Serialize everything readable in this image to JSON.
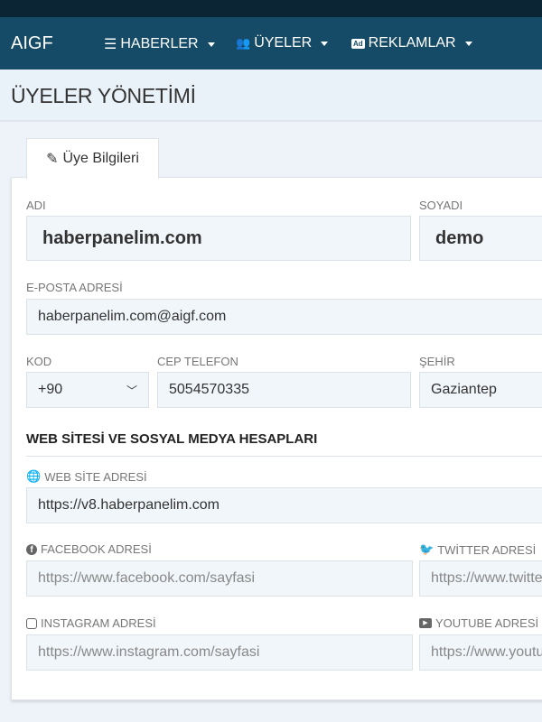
{
  "nav": {
    "brand": "AIGF",
    "items": [
      {
        "label": "HABERLER",
        "icon": "list-icon"
      },
      {
        "label": "ÜYELER",
        "icon": "users-icon"
      },
      {
        "label": "REKLAMLAR",
        "icon": "ad-icon"
      }
    ]
  },
  "page": {
    "title": "ÜYELER YÖNETİMİ"
  },
  "tab": {
    "label": "Üye Bilgileri",
    "icon": "pencil-icon"
  },
  "form": {
    "adi": {
      "label": "ADI",
      "value": "haberpanelim.com"
    },
    "soyadi": {
      "label": "SOYADI",
      "value": "demo"
    },
    "email": {
      "label": "E-POSTA ADRESİ",
      "value": "haberpanelim.com@aigf.com"
    },
    "kod": {
      "label": "KOD",
      "value": "+90"
    },
    "cep": {
      "label": "CEP TELEFON",
      "value": "5054570335"
    },
    "sehir": {
      "label": "ŞEHİR",
      "value": "Gaziantep"
    },
    "section": "WEB SİTESİ VE SOSYAL MEDYA HESAPLARI",
    "web": {
      "label": "WEB SİTE ADRESİ",
      "value": "https://v8.haberpanelim.com"
    },
    "facebook": {
      "label": "FACEBOOK ADRESİ",
      "placeholder": "https://www.facebook.com/sayfasi"
    },
    "twitter": {
      "label": "TWİTTER ADRESİ",
      "placeholder": "https://www.twitter.com/sayfasi"
    },
    "instagram": {
      "label": "INSTAGRAM ADRESİ",
      "placeholder": "https://www.instagram.com/sayfasi"
    },
    "youtube": {
      "label": "YOUTUBE ADRESİ",
      "placeholder": "https://www.youtube.com/sayfasi"
    }
  }
}
